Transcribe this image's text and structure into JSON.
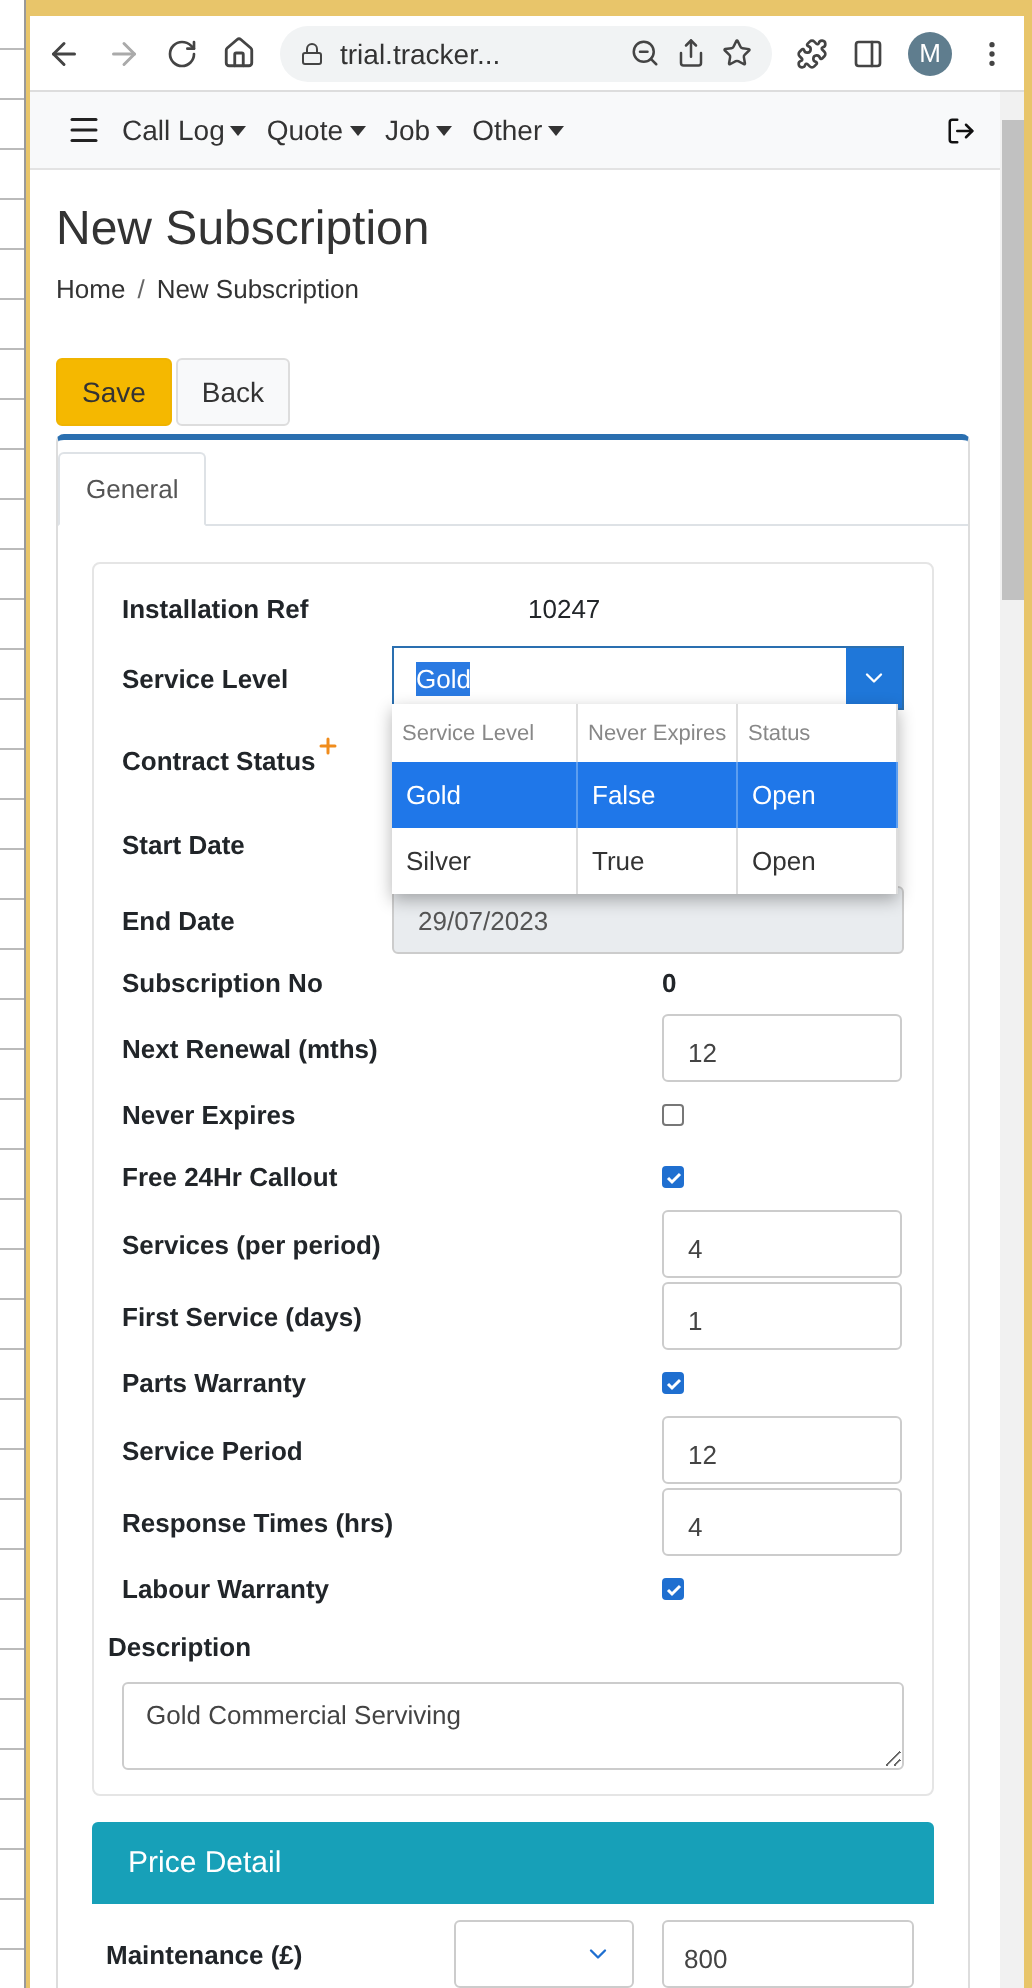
{
  "browser": {
    "url": "trial.tracker...",
    "profile_initial": "M"
  },
  "navbar": {
    "menu_items": [
      "Call Log",
      "Quote",
      "Job",
      "Other"
    ]
  },
  "page": {
    "title": "New Subscription",
    "breadcrumb": [
      "Home",
      "New Subscription"
    ],
    "breadcrumb_separator": "/"
  },
  "actions": [
    {
      "label": "Save",
      "kind": "primary"
    },
    {
      "label": "Back",
      "kind": "secondary"
    }
  ],
  "tabs": [
    {
      "label": "General",
      "selected": true
    }
  ],
  "form": {
    "rows": [
      {
        "label": "Installation Ref",
        "kind": "text",
        "value": "10247"
      },
      {
        "label": "Service Level",
        "kind": "select",
        "value": "Gold"
      },
      {
        "label": "Contract Status",
        "kind": "label",
        "required": true
      },
      {
        "label": "Start Date",
        "kind": "label"
      },
      {
        "label": "End Date",
        "kind": "date",
        "value": "29/07/2023"
      },
      {
        "label": "Subscription No",
        "kind": "text",
        "value": "0"
      },
      {
        "label": "Next Renewal (mths)",
        "kind": "input",
        "value": "12"
      },
      {
        "label": "Never Expires",
        "kind": "checkbox",
        "checked": false
      },
      {
        "label": "Free 24Hr Callout",
        "kind": "checkbox",
        "checked": true
      },
      {
        "label": "Services (per period)",
        "kind": "input",
        "value": "4"
      },
      {
        "label": "First Service (days)",
        "kind": "input",
        "value": "1"
      },
      {
        "label": "Parts Warranty",
        "kind": "checkbox",
        "checked": true
      },
      {
        "label": "Service Period",
        "kind": "input",
        "value": "12"
      },
      {
        "label": "Response Times (hrs)",
        "kind": "input",
        "value": "4"
      },
      {
        "label": "Labour Warranty",
        "kind": "checkbox",
        "checked": true
      }
    ],
    "description": {
      "label": "Description",
      "value": "Gold Commercial Serviving"
    }
  },
  "dropdown": {
    "columns": [
      "Service Level",
      "Never Expires",
      "Status"
    ],
    "rows": [
      {
        "cells": [
          "Gold",
          "False",
          "Open"
        ],
        "selected": true
      },
      {
        "cells": [
          "Silver",
          "True",
          "Open"
        ],
        "selected": false
      }
    ]
  },
  "price_detail": {
    "title": "Price Detail",
    "rows": [
      {
        "label": "Maintenance (£)",
        "value": "800"
      }
    ]
  }
}
